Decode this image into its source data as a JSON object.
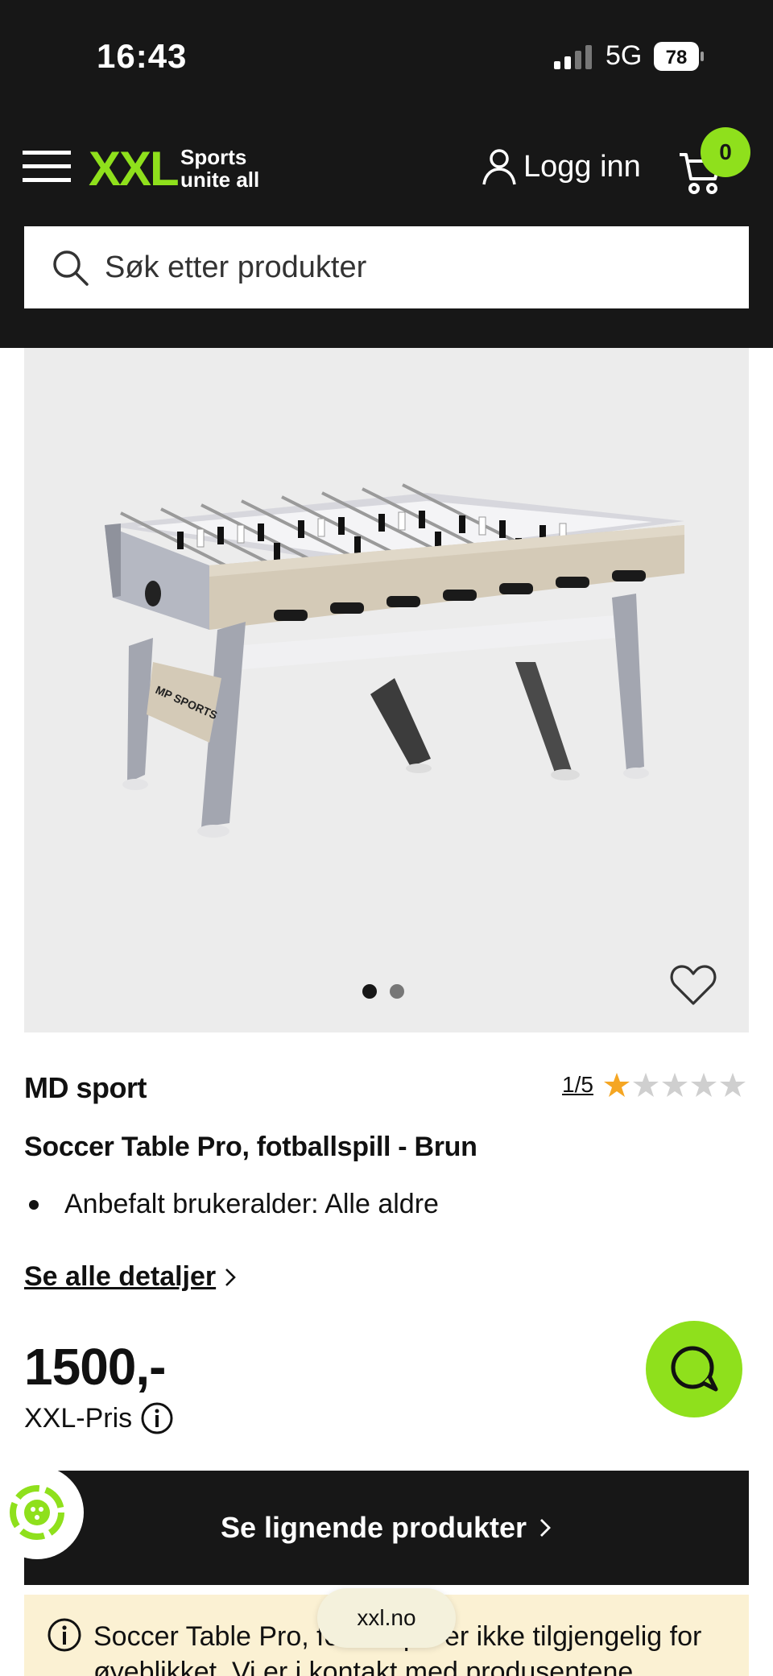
{
  "status_bar": {
    "time": "16:43",
    "network": "5G",
    "battery": "78"
  },
  "header": {
    "logo_text": "XXL",
    "logo_tagline_1": "Sports",
    "logo_tagline_2": "unite all",
    "login_label": "Logg inn",
    "cart_count": "0"
  },
  "search": {
    "placeholder": "Søk etter produkter"
  },
  "gallery": {
    "image_count": 2,
    "active_index": 0,
    "product_image_logo_text": "MP SPORTS"
  },
  "product": {
    "brand": "MD sport",
    "rating": "1/5",
    "rating_value": 1,
    "rating_max": 5,
    "name": "Soccer Table Pro, fotballspill - Brun",
    "features": [
      "Anbefalt brukeralder: Alle aldre"
    ],
    "details_link": "Se alle detaljer",
    "price": "1500,-",
    "price_label": "XXL-Pris"
  },
  "similar_button": "Se lignende produkter",
  "notice": {
    "text": "Soccer Table Pro, fotballspill er ikke tilgjengelig for øyeblikket. Vi er i kontakt med produsentene"
  },
  "url_pill": "xxl.no",
  "colors": {
    "brand_green": "#8fe01c",
    "header_bg": "#171717",
    "notice_bg": "#fbf1d3",
    "star_filled": "#f5a623",
    "star_empty": "#cfcfcf"
  },
  "icons": [
    "menu-icon",
    "user-icon",
    "cart-icon",
    "search-icon",
    "heart-icon",
    "star-icon",
    "chevron-right-icon",
    "info-icon",
    "chat-icon",
    "loyalty-icon"
  ]
}
